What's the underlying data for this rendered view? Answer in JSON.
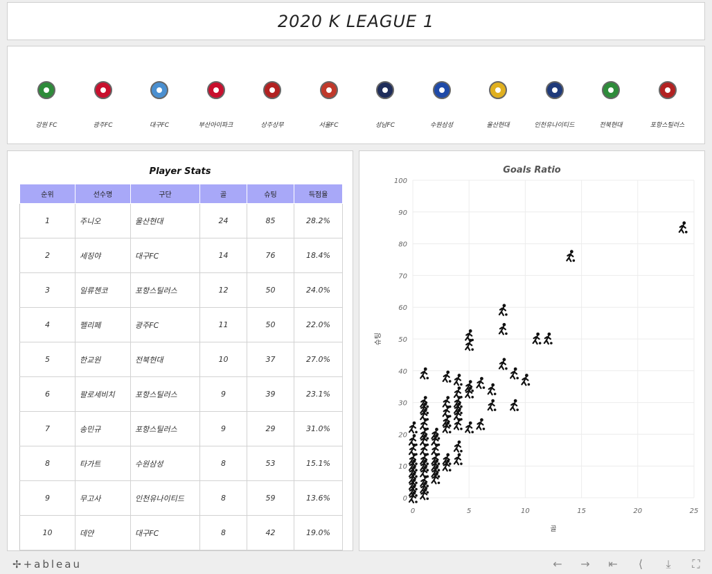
{
  "title": "2020 K LEAGUE 1",
  "teams": [
    {
      "name": "강원 FC",
      "color": "#2e8b3a"
    },
    {
      "name": "광주FC",
      "color": "#c8102e"
    },
    {
      "name": "대구FC",
      "color": "#4a8fd0"
    },
    {
      "name": "부산아이파크",
      "color": "#c8102e"
    },
    {
      "name": "상주상무",
      "color": "#b22222"
    },
    {
      "name": "서울FC",
      "color": "#c0392b"
    },
    {
      "name": "성남FC",
      "color": "#1f2d5a"
    },
    {
      "name": "수원삼성",
      "color": "#1f4aa8"
    },
    {
      "name": "울산현대",
      "color": "#e0b020"
    },
    {
      "name": "인천유나이티드",
      "color": "#1f3a7a"
    },
    {
      "name": "전북현대",
      "color": "#2e8b3a"
    },
    {
      "name": "포항스틸러스",
      "color": "#b22222"
    }
  ],
  "stats": {
    "title": "Player Stats",
    "header_color": "#a8a8f8",
    "columns": [
      "순위",
      "선수명",
      "구단",
      "골",
      "슈팅",
      "득점율"
    ],
    "rows": [
      [
        "1",
        "주니오",
        "울산현대",
        "24",
        "85",
        "28.2%"
      ],
      [
        "2",
        "세징야",
        "대구FC",
        "14",
        "76",
        "18.4%"
      ],
      [
        "3",
        "일류첸코",
        "포항스틸러스",
        "12",
        "50",
        "24.0%"
      ],
      [
        "4",
        "펠리페",
        "광주FC",
        "11",
        "50",
        "22.0%"
      ],
      [
        "5",
        "한교원",
        "전북현대",
        "10",
        "37",
        "27.0%"
      ],
      [
        "6",
        "팔로세비치",
        "포항스틸러스",
        "9",
        "39",
        "23.1%"
      ],
      [
        "7",
        "송민규",
        "포항스틸러스",
        "9",
        "29",
        "31.0%"
      ],
      [
        "8",
        "타가트",
        "수원삼성",
        "8",
        "53",
        "15.1%"
      ],
      [
        "9",
        "무고사",
        "인천유나이티드",
        "8",
        "59",
        "13.6%"
      ],
      [
        "10",
        "데얀",
        "대구FC",
        "8",
        "42",
        "19.0%"
      ]
    ]
  },
  "chart_data": {
    "type": "scatter",
    "title": "Goals Ratio",
    "xlabel": "골",
    "ylabel": "슈팅",
    "xlim": [
      0,
      25
    ],
    "ylim": [
      0,
      100
    ],
    "xticks": [
      0,
      5,
      10,
      15,
      20,
      25
    ],
    "yticks": [
      0,
      10,
      20,
      30,
      40,
      50,
      60,
      70,
      80,
      90,
      100
    ],
    "grid": true,
    "marker": "player-icon",
    "points": [
      [
        24,
        85
      ],
      [
        14,
        76
      ],
      [
        12,
        50
      ],
      [
        11,
        50
      ],
      [
        10,
        37
      ],
      [
        9,
        39
      ],
      [
        9,
        29
      ],
      [
        8,
        53
      ],
      [
        8,
        59
      ],
      [
        8,
        42
      ],
      [
        6,
        36
      ],
      [
        6,
        23
      ],
      [
        7,
        34
      ],
      [
        7,
        29
      ],
      [
        5,
        51
      ],
      [
        5,
        48
      ],
      [
        5,
        35
      ],
      [
        5,
        33
      ],
      [
        5,
        22
      ],
      [
        4,
        37
      ],
      [
        4,
        33
      ],
      [
        4,
        30
      ],
      [
        4,
        28
      ],
      [
        4,
        26
      ],
      [
        4,
        23
      ],
      [
        4,
        16
      ],
      [
        4,
        12
      ],
      [
        3,
        38
      ],
      [
        3,
        30
      ],
      [
        3,
        27
      ],
      [
        3,
        24
      ],
      [
        3,
        22
      ],
      [
        3,
        12
      ],
      [
        3,
        10
      ],
      [
        2,
        20
      ],
      [
        2,
        18
      ],
      [
        2,
        15
      ],
      [
        2,
        12
      ],
      [
        2,
        10
      ],
      [
        2,
        8
      ],
      [
        2,
        6
      ],
      [
        1,
        39
      ],
      [
        1,
        30
      ],
      [
        1,
        28
      ],
      [
        1,
        26
      ],
      [
        1,
        23
      ],
      [
        1,
        20
      ],
      [
        1,
        18
      ],
      [
        1,
        15
      ],
      [
        1,
        12
      ],
      [
        1,
        10
      ],
      [
        1,
        8
      ],
      [
        1,
        5
      ],
      [
        1,
        3
      ],
      [
        1,
        1
      ],
      [
        0,
        22
      ],
      [
        0,
        18
      ],
      [
        0,
        15
      ],
      [
        0,
        12
      ],
      [
        0,
        10
      ],
      [
        0,
        8
      ],
      [
        0,
        6
      ],
      [
        0,
        4
      ],
      [
        0,
        2
      ],
      [
        0,
        0
      ]
    ]
  },
  "footer": {
    "brand": "+ableau",
    "icons": [
      "back-arrow-icon",
      "forward-arrow-icon",
      "revert-icon",
      "share-icon",
      "download-icon",
      "fullscreen-icon"
    ]
  }
}
